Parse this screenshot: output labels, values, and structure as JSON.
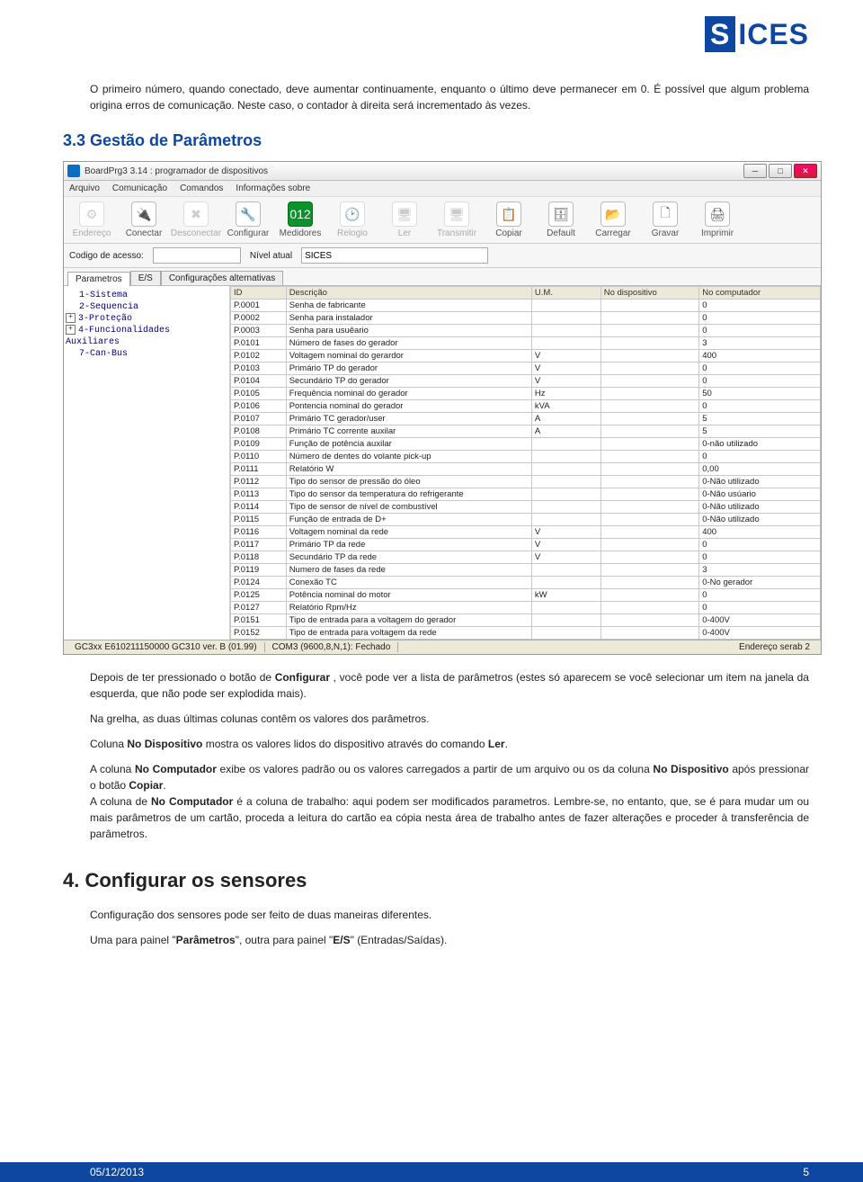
{
  "logo": "ICES",
  "intro": "O primeiro número, quando conectado, deve aumentar continuamente, enquanto o último deve permanecer em 0. É possível que algum problema origina erros de comunicação. Neste caso, o contador à direita será incrementado às vezes.",
  "h3": "3.3   Gestão de Parâmetros",
  "app": {
    "title": "BoardPrg3 3.14 : programador de dispositivos",
    "menu": [
      "Arquivo",
      "Comunicação",
      "Comandos",
      "Informações sobre"
    ],
    "tools": [
      {
        "label": "Endereço",
        "glyph": "⚙",
        "disabled": true
      },
      {
        "label": "Conectar",
        "glyph": "🔌"
      },
      {
        "label": "Desconectar",
        "glyph": "✖",
        "disabled": true
      },
      {
        "label": "Configurar",
        "glyph": "🔧"
      },
      {
        "label": "Medidores",
        "glyph": "012",
        "active": true
      },
      {
        "label": "Relogio",
        "glyph": "🕑",
        "disabled": true
      },
      {
        "label": "Ler",
        "glyph": "🖥",
        "disabled": true
      },
      {
        "label": "Transmitir",
        "glyph": "🖥",
        "disabled": true
      },
      {
        "label": "Copiar",
        "glyph": "📋"
      },
      {
        "label": "Default",
        "glyph": "🗄"
      },
      {
        "label": "Carregar",
        "glyph": "📂"
      },
      {
        "label": "Gravar",
        "glyph": "🗋"
      },
      {
        "label": "Imprimir",
        "glyph": "🖨"
      }
    ],
    "access_label": "Codigo de acesso:",
    "level_label": "Nível atual",
    "level_value": "SICES",
    "tabs": [
      "Parametros",
      "E/S",
      "Configurações alternativas"
    ],
    "tree": [
      {
        "t": "leaf",
        "label": "1-Sistema"
      },
      {
        "t": "leaf",
        "label": "2-Sequencia"
      },
      {
        "t": "plus",
        "label": "3-Proteção"
      },
      {
        "t": "plus",
        "label": "4-Funcionalidades Auxiliares"
      },
      {
        "t": "leaf",
        "label": "7-Can-Bus"
      }
    ],
    "headers": [
      "ID",
      "Descrição",
      "U.M.",
      "No dispositivo",
      "No computador"
    ],
    "rows": [
      [
        "P.0001",
        "Senha de fabricante",
        "",
        "",
        "0"
      ],
      [
        "P.0002",
        "Senha para instalador",
        "",
        "",
        "0"
      ],
      [
        "P.0003",
        "Senha para usuêario",
        "",
        "",
        "0"
      ],
      [
        "P.0101",
        "Número de fases do gerador",
        "",
        "",
        "3"
      ],
      [
        "P.0102",
        "Voltagem nominal do gerardor",
        "V",
        "",
        "400"
      ],
      [
        "P.0103",
        "Primário TP do gerador",
        "V",
        "",
        "0"
      ],
      [
        "P.0104",
        "Secundário TP do gerador",
        "V",
        "",
        "0"
      ],
      [
        "P.0105",
        "Frequência nominal do gerador",
        "Hz",
        "",
        "50"
      ],
      [
        "P.0106",
        "Pontencia nominal do gerador",
        "kVA",
        "",
        "0"
      ],
      [
        "P.0107",
        "Primário TC gerador/user",
        "A",
        "",
        "5"
      ],
      [
        "P.0108",
        "Primário TC corrente auxilar",
        "A",
        "",
        "5"
      ],
      [
        "P.0109",
        "Função de potência auxilar",
        "",
        "",
        "0-não utilizado"
      ],
      [
        "P.0110",
        "Número de dentes do volante pick-up",
        "",
        "",
        "0"
      ],
      [
        "P.0111",
        "Relatório W",
        "",
        "",
        "0,00"
      ],
      [
        "P.0112",
        "Tipo do sensor de pressão do óleo",
        "",
        "",
        "0-Não utilizado"
      ],
      [
        "P.0113",
        "Tipo do sensor da temperatura do refrigerante",
        "",
        "",
        "0-Não usúario"
      ],
      [
        "P.0114",
        "Tipo de sensor de nível de combustível",
        "",
        "",
        "0-Não utilizado"
      ],
      [
        "P.0115",
        "Função de entrada de D+",
        "",
        "",
        "0-Não utilizado"
      ],
      [
        "P.0116",
        "Voltagem nominal da rede",
        "V",
        "",
        "400"
      ],
      [
        "P.0117",
        "Primário TP da rede",
        "V",
        "",
        "0"
      ],
      [
        "P.0118",
        "Secundário TP da rede",
        "V",
        "",
        "0"
      ],
      [
        "P.0119",
        "Numero de fases da rede",
        "",
        "",
        "3"
      ],
      [
        "P.0124",
        "Conexão TC",
        "",
        "",
        "0-No gerador"
      ],
      [
        "P.0125",
        "Potência nominal do motor",
        "kW",
        "",
        "0"
      ],
      [
        "P.0127",
        "Relatório Rpm/Hz",
        "",
        "",
        "0"
      ],
      [
        "P.0151",
        "Tipo de entrada para a voltagem do gerador",
        "",
        "",
        "0-400V"
      ],
      [
        "P.0152",
        "Tipo de entrada para voltagem da rede",
        "",
        "",
        "0-400V"
      ]
    ],
    "status": {
      "left": "GC3xx E610211150000 GC310 ver. B (01.99)",
      "mid": "COM3 (9600,8,N,1): Fechado",
      "right": "Endereço serab 2"
    }
  },
  "after": [
    "Depois de ter pressionado o botão de <b>Configurar</b> , você pode ver a lista de parâmetros (estes só aparecem se você selecionar um item na janela da esquerda, que não pode ser explodida mais).",
    "Na grelha, as duas últimas colunas contêm os valores dos parâmetros.",
    "Coluna <b>No Dispositivo</b> mostra os valores lidos do dispositivo através do comando <b>Ler</b>.",
    "A coluna <b>No Computador</b> exibe os valores padrão ou os valores carregados a partir de um arquivo ou os da coluna <b>No Dispositivo</b> após pressionar o botão <b>Copiar</b>.<br>A coluna de <b>No Computador</b> é a coluna de trabalho: aqui podem ser modificados parametros. Lembre-se, no entanto, que, se é para mudar um ou mais parâmetros de um cartão, proceda a leitura do cartão ea cópia nesta área de trabalho antes de fazer alterações e proceder à transferência de parâmetros."
  ],
  "h2": "4.   Configurar os sensores",
  "after2": [
    "Configuração dos sensores pode ser feito de duas maneiras diferentes.",
    "Uma para painel \"<b>Parâmetros</b>\", outra para painel \"<b>E/S</b>\" (Entradas/Saídas)."
  ],
  "footer": {
    "date": "05/12/2013",
    "page": "5"
  }
}
